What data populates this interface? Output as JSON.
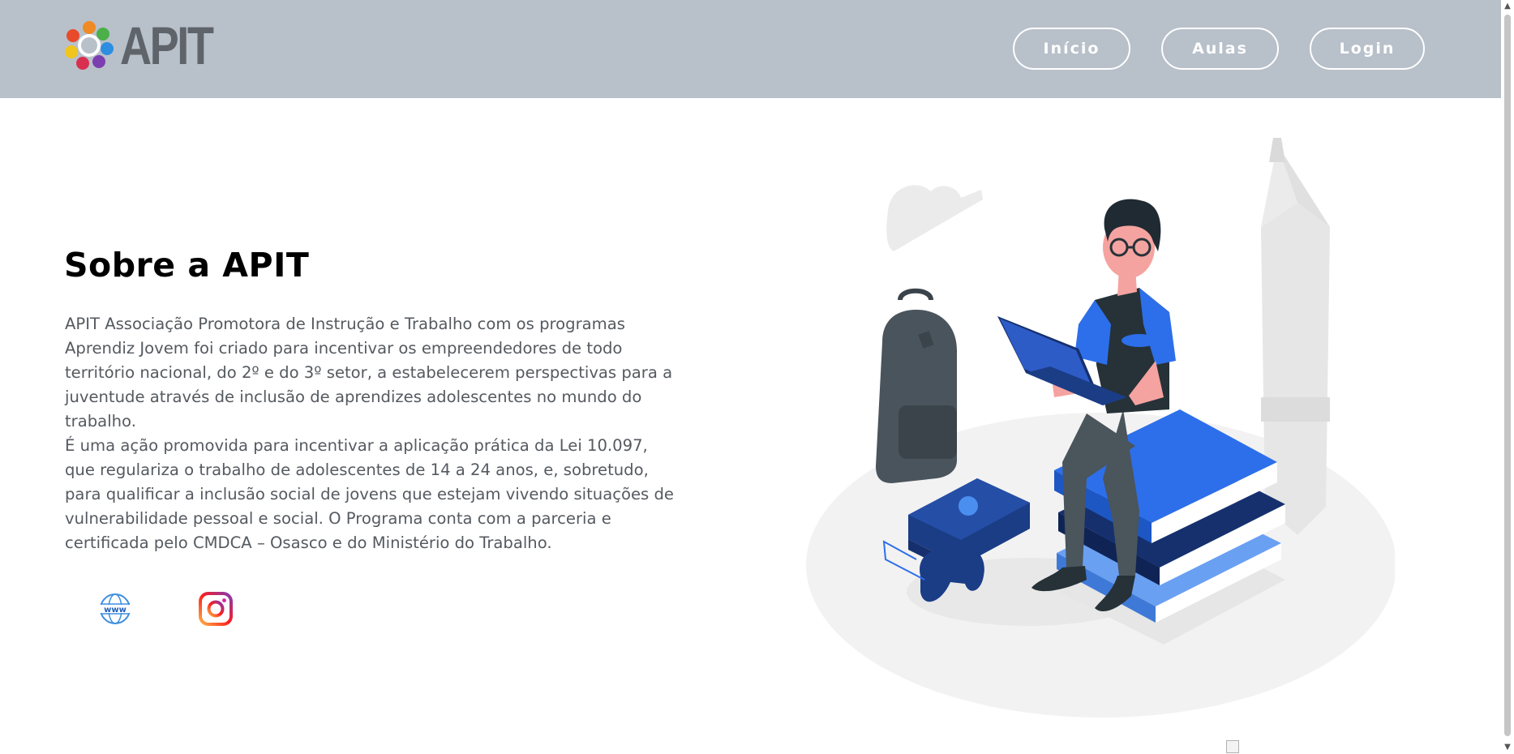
{
  "header": {
    "logo_text": "APIT",
    "nav": {
      "inicio": "Início",
      "aulas": "Aulas",
      "login": "Login"
    }
  },
  "main": {
    "title": "Sobre a APIT",
    "paragraph1": "APIT Associação Promotora de Instrução e Trabalho com os programas Aprendiz Jovem foi criado para incentivar os empreendedores de todo território nacional, do 2º e do 3º setor, a estabelecerem perspectivas para a juventude através de inclusão de aprendizes adolescentes no mundo do trabalho.",
    "paragraph2": "É uma ação promovida para incentivar a aplicação prática da Lei 10.097, que regulariza o trabalho de adolescentes de 14 a 24 anos, e, sobretudo, para qualificar a inclusão social de jovens que estejam vivendo situações de vulnerabilidade pessoal e social. O Programa conta com a parceria e certificada pelo CMDCA – Osasco e do Ministério do Trabalho."
  },
  "social": {
    "website_icon": "www",
    "instagram_icon": "instagram-icon"
  },
  "colors": {
    "header_bg": "#b8c0ca",
    "accent_blue": "#2d6fea",
    "dark_navy": "#16306e"
  }
}
